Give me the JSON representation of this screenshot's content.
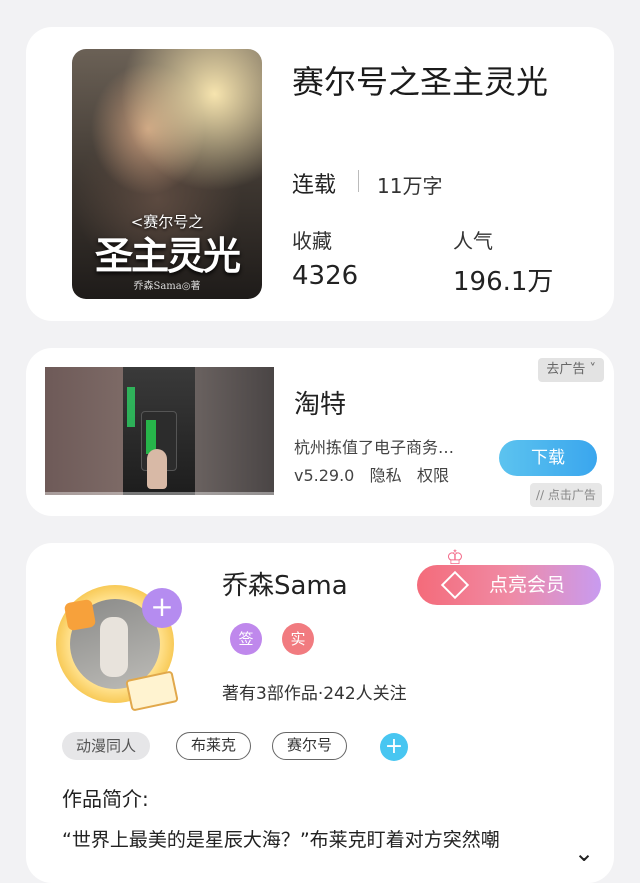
{
  "book": {
    "cover": {
      "series": "<赛尔号之",
      "title": "圣主灵光",
      "author": "乔森Sama◎著"
    },
    "title": "赛尔号之圣主灵光",
    "status": "连载",
    "word_count": "11万字",
    "favorites": {
      "label": "收藏",
      "value": "4326"
    },
    "popularity": {
      "label": "人气",
      "value": "196.1万"
    }
  },
  "ad": {
    "go_ad_label": "去广告 ˅",
    "app_name": "淘特",
    "description": "杭州拣值了电子商务…",
    "version": "v5.29.0",
    "privacy_label": "隐私",
    "permission_label": "权限",
    "download_label": "下载",
    "ad_mark": "∕∕ 点击广告"
  },
  "author": {
    "name": "乔森Sama",
    "vip_label": "点亮会员",
    "badge_sign": "签",
    "badge_real": "实",
    "stats": "著有3部作品·242人关注",
    "tags": [
      "动漫同人",
      "布莱克",
      "赛尔号"
    ],
    "intro_label": "作品简介:",
    "intro_text": "“世界上最美的是星辰大海？”布莱克盯着对方突然嘲",
    "expand_icon": "chevron-down"
  },
  "colors": {
    "accent_blue": "#3aa6ee",
    "vip_pink": "#f46b7a",
    "badge_purple": "#bf88ec",
    "badge_red": "#f17b80",
    "tag_add_blue": "#48c6f1"
  }
}
